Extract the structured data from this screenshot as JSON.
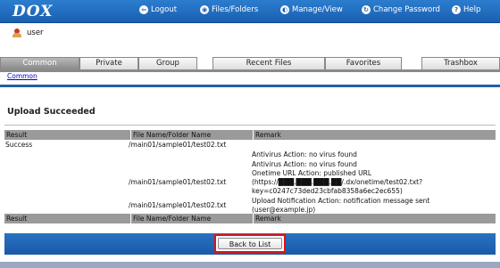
{
  "app": {
    "logo": "DOX"
  },
  "nav": [
    {
      "label": "Logout",
      "icon": "logout-icon",
      "glyph": "⇦"
    },
    {
      "label": "Files/Folders",
      "icon": "files-icon",
      "glyph": "◉"
    },
    {
      "label": "Manage/View",
      "icon": "manage-icon",
      "glyph": "◐"
    },
    {
      "label": "Change Password",
      "icon": "password-icon",
      "glyph": "↻"
    },
    {
      "label": "Help",
      "icon": "help-icon",
      "glyph": "?"
    }
  ],
  "user": {
    "name": "user"
  },
  "tabs": [
    {
      "label": "Common",
      "active": true
    },
    {
      "label": "Private",
      "active": false
    },
    {
      "label": "Group",
      "active": false
    },
    {
      "label": "Recent Files",
      "active": false
    },
    {
      "label": "Favorites",
      "active": false
    },
    {
      "label": "Trashbox",
      "active": false
    }
  ],
  "breadcrumb": "Common",
  "page": {
    "heading": "Upload Succeeded"
  },
  "table": {
    "headers": [
      "Result",
      "File Name/Folder Name",
      "Remark"
    ],
    "result": "Success",
    "rows": [
      {
        "file": "/main01/sample01/test02.txt",
        "remark": []
      },
      {
        "file": "",
        "remark": [
          "Antivirus Action: no virus found"
        ]
      },
      {
        "file": "",
        "remark": [
          "Antivirus Action: no virus found"
        ]
      },
      {
        "file": "/main01/sample01/test02.txt",
        "remark": [
          "Onetime URL Action: published URL",
          "(https://███.███.███.██/.dx/onetime/test02.txt?",
          "key=c0247c73ded23cbfab8358a6ec2ec655)"
        ]
      },
      {
        "file": "/main01/sample01/test02.txt",
        "remark": [
          "Upload Notification Action: notification message sent",
          "(user@example.jp)"
        ]
      }
    ]
  },
  "actions": {
    "back_label": "Back to List"
  },
  "colors": {
    "header_blue": "#1a5fb0",
    "highlight_red": "#e01010"
  }
}
